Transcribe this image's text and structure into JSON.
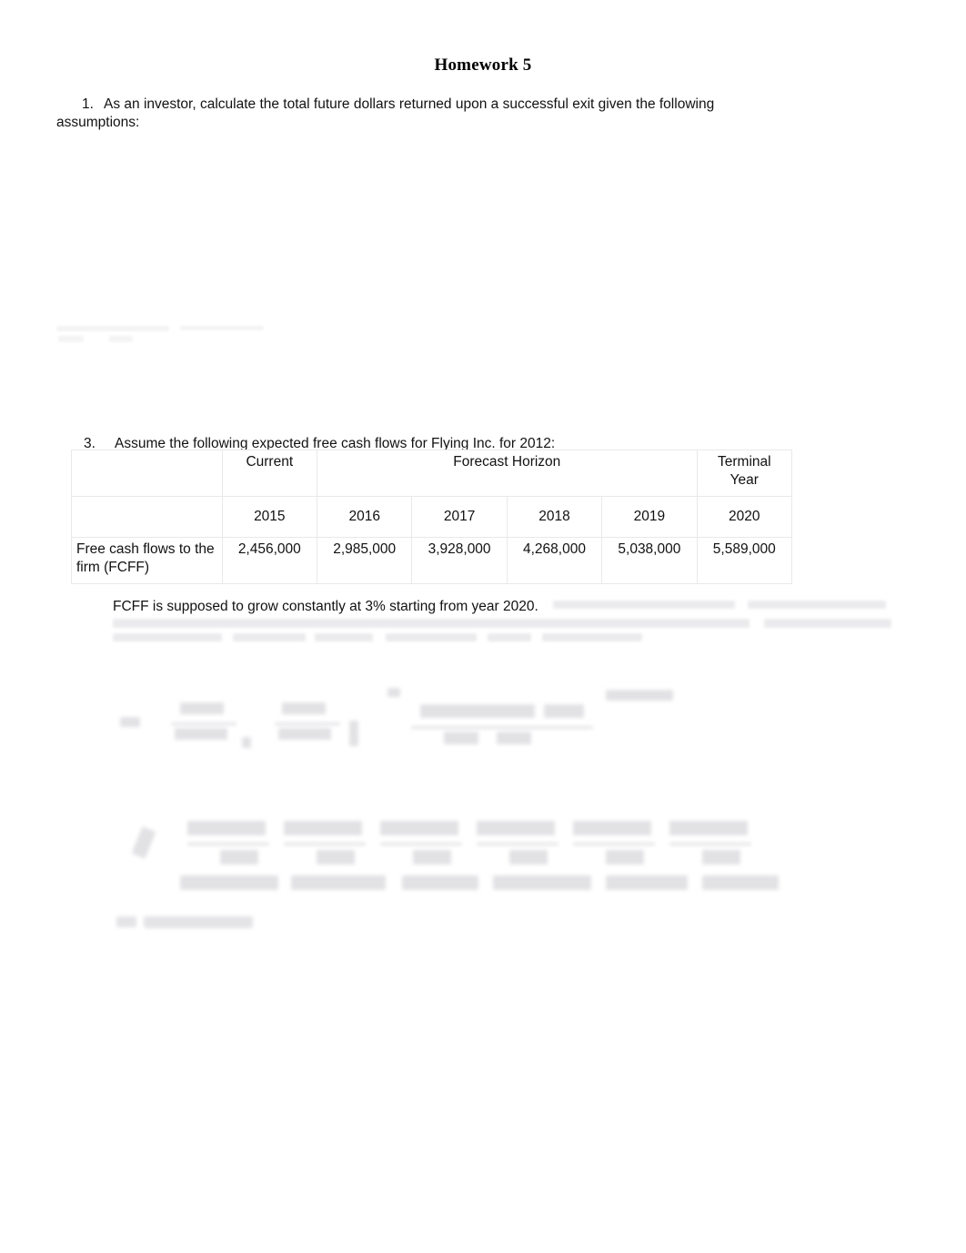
{
  "document": {
    "title": "Homework 5"
  },
  "questions": [
    {
      "number": "1.",
      "text": "As an investor, calculate the total future dollars returned upon a successful exit given the following assumptions:"
    },
    {
      "number": "3.",
      "text": "Assume the following expected free cash flows for Flying Inc. for 2012:"
    }
  ],
  "table": {
    "header_groups": {
      "label_col": "",
      "current": "Current",
      "forecast_horizon": "Forecast Horizon",
      "terminal_year_line1": "Terminal",
      "terminal_year_line2": "Year"
    },
    "year_row": {
      "label": "",
      "years": [
        "2015",
        "2016",
        "2017",
        "2018",
        "2019",
        "2020"
      ]
    },
    "data_row": {
      "label": "Free cash flows to the firm (FCFF)",
      "values": [
        "2,456,000",
        "2,985,000",
        "3,928,000",
        "4,268,000",
        "5,038,000",
        "5,589,000"
      ]
    }
  },
  "notes": {
    "fcff_growth": "FCFF is supposed to grow constantly at 3% starting from year 2020."
  },
  "colors": {
    "page_background": "#ffffff",
    "text": "#121212",
    "table_border": "#e9e9ec",
    "faded_ink": "#e2e2e5"
  }
}
